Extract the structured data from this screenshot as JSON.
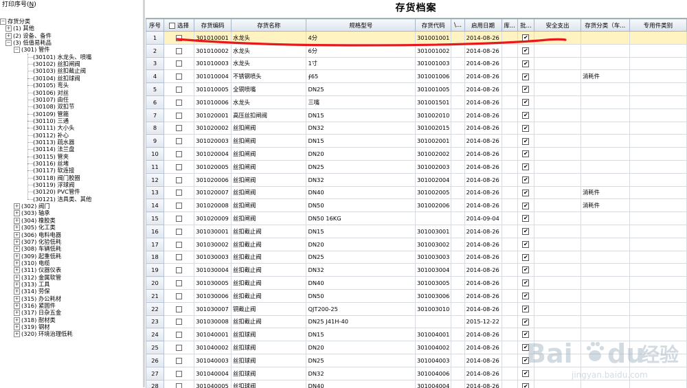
{
  "toolbar": {
    "print_label": "打印序号(",
    "print_key": "N",
    "print_close": ")"
  },
  "page_title": "存货档案",
  "tree": {
    "root": "存货分类",
    "level1": [
      {
        "label": "(1) 其他",
        "expanded": false
      },
      {
        "label": "(2) 设备、备件",
        "expanded": false
      },
      {
        "label": "(3) 低值易耗品",
        "expanded": true
      }
    ],
    "level2_expanded": "(301) 管件",
    "level3": [
      "(30101) 水龙头、喷嘴",
      "(30102) 丝扣闸阀",
      "(30103) 丝扣截止阀",
      "(30104) 丝扣球阀",
      "(30105) 弯头",
      "(30106) 对丝",
      "(30107) 由任",
      "(30108) 双扣节",
      "(30109) 管箍",
      "(30110) 三通",
      "(30111) 大小头",
      "(30112) 补心",
      "(30113) 疏水器",
      "(30114) 法兰盘",
      "(30115) 管夹",
      "(30116) 丝堵",
      "(30117) 软连接",
      "(30118) 阀门胶圈",
      "(30119) 浮球阀",
      "(30120) PVC管件",
      "(30121) 洁具类、其他"
    ],
    "level2": [
      "(302) 阀门",
      "(303) 轴承",
      "(304) 橡胶类",
      "(305) 化工类",
      "(306) 电料电器",
      "(307) 化验低耗",
      "(308) 车辆低耗",
      "(309) 起重低耗",
      "(310) 电缆",
      "(311) 仪器仪表",
      "(312) 金属软管",
      "(313) 工具",
      "(314) 劳保",
      "(315) 办公耗材",
      "(316) 紧固件",
      "(317) 日杂五金",
      "(318) 耐材类",
      "(319) 钢材",
      "(320) 环境治理低耗"
    ]
  },
  "table": {
    "columns": [
      "序号",
      "选择",
      "存货编码",
      "存货名称",
      "规格型号",
      "存货代码",
      "\\...",
      "启用日期",
      "库...",
      "批...",
      "安全支出",
      "存货分类（车...",
      "专用件类别"
    ],
    "rows": [
      [
        "1",
        "301010001",
        "水龙头",
        "4分",
        "301001001",
        "2014-08-26",
        ""
      ],
      [
        "2",
        "301010002",
        "水龙头",
        "6分",
        "301001002",
        "2014-08-26",
        ""
      ],
      [
        "3",
        "301010003",
        "水龙头",
        "1寸",
        "301001003",
        "2014-08-26",
        ""
      ],
      [
        "4",
        "301010004",
        "不锈钢喷头",
        "∮65",
        "301001006",
        "2014-08-26",
        "消耗件"
      ],
      [
        "5",
        "301010005",
        "全铜喷嘴",
        "DN25",
        "301001005",
        "2014-08-26",
        ""
      ],
      [
        "6",
        "301010006",
        "水龙头",
        "三嘴",
        "301001501",
        "2014-08-26",
        ""
      ],
      [
        "7",
        "301020001",
        "高压丝扣闸阀",
        "DN15",
        "301002010",
        "2014-08-26",
        ""
      ],
      [
        "8",
        "301020002",
        "丝扣闸阀",
        "DN32",
        "301002015",
        "2014-08-26",
        ""
      ],
      [
        "9",
        "301020003",
        "丝扣闸阀",
        "DN15",
        "301002001",
        "2014-08-26",
        ""
      ],
      [
        "10",
        "301020004",
        "丝扣闸阀",
        "DN20",
        "301002002",
        "2014-08-26",
        ""
      ],
      [
        "11",
        "301020005",
        "丝扣闸阀",
        "DN25",
        "301002003",
        "2014-08-26",
        ""
      ],
      [
        "12",
        "301020006",
        "丝扣闸阀",
        "DN32",
        "301002004",
        "2014-08-26",
        ""
      ],
      [
        "13",
        "301020007",
        "丝扣闸阀",
        "DN40",
        "301002005",
        "2014-08-26",
        "消耗件"
      ],
      [
        "14",
        "301020008",
        "丝扣闸阀",
        "DN50",
        "301002006",
        "2014-08-26",
        "消耗件"
      ],
      [
        "15",
        "301020009",
        "丝扣闸阀",
        "DN50 16KG",
        "",
        "2014-09-04",
        ""
      ],
      [
        "16",
        "301030001",
        "丝扣截止阀",
        "DN15",
        "301003001",
        "2014-08-26",
        ""
      ],
      [
        "17",
        "301030002",
        "丝扣截止阀",
        "DN20",
        "301003002",
        "2014-08-26",
        ""
      ],
      [
        "18",
        "301030003",
        "丝扣截止阀",
        "DN25",
        "301003003",
        "2014-08-26",
        ""
      ],
      [
        "19",
        "301030004",
        "丝扣截止阀",
        "DN32",
        "301003004",
        "2014-08-26",
        ""
      ],
      [
        "20",
        "301030005",
        "丝扣截止阀",
        "DN40",
        "301003005",
        "2014-08-26",
        ""
      ],
      [
        "21",
        "301030006",
        "丝扣截止阀",
        "DN50",
        "301003006",
        "2014-08-26",
        ""
      ],
      [
        "22",
        "301030007",
        "铜截止阀",
        "QJT200-25",
        "301003010",
        "2014-08-26",
        ""
      ],
      [
        "23",
        "301030008",
        "丝扣截止阀",
        "DN25 J41H-40",
        "",
        "2015-12-22",
        ""
      ],
      [
        "24",
        "301040001",
        "丝扣球阀",
        "DN15",
        "301004001",
        "2014-08-26",
        ""
      ],
      [
        "25",
        "301040002",
        "丝扣球阀",
        "DN20",
        "301004002",
        "2014-08-26",
        ""
      ],
      [
        "26",
        "301040003",
        "丝扣球阀",
        "DN25",
        "301004003",
        "2014-08-26",
        ""
      ],
      [
        "27",
        "301040004",
        "丝扣球阀",
        "DN32",
        "301004006",
        "2014-08-26",
        ""
      ],
      [
        "28",
        "301040005",
        "丝扣球阀",
        "DN40",
        "301004004",
        "2014-08-26",
        ""
      ]
    ]
  },
  "watermark": {
    "brand": "Bai",
    "brand2": "du",
    "cn": "经验",
    "url": "jingyan.baidu.com"
  },
  "colors": {
    "annotation": "#e8191c",
    "selected_row": "#fff3c2",
    "header": "#dde4ee"
  }
}
